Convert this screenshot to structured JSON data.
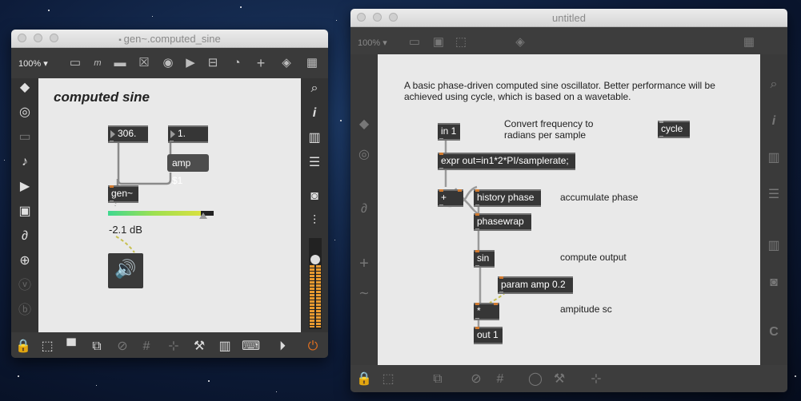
{
  "left_window": {
    "title": "gen~.computed_sine",
    "zoom": "100%",
    "patcher_title": "computed sine",
    "objects": {
      "number1": "306.",
      "number2": "1.",
      "amp_msg": "amp $1",
      "gen": "gen~",
      "gain_readout": "-2.1 dB"
    },
    "gain_level": 0.88,
    "toolbar_icons": [
      "presentation-icon",
      "math-icon",
      "comment-icon",
      "close-box-icon",
      "button-icon",
      "play-icon",
      "slider-icon",
      "dial-icon",
      "plus-icon",
      "paint-bucket-icon",
      "grid-icon"
    ],
    "sidebar_left_icons": [
      "cube-icon",
      "target-icon",
      "panel-icon",
      "music-note-icon",
      "play-list-icon",
      "image-icon",
      "paperclip-icon",
      "plug-icon",
      "v-icon",
      "b-icon"
    ],
    "sidebar_right_icons": [
      "search-icon",
      "info-icon",
      "book-icon",
      "list-icon",
      "camera-icon",
      "mixer-icon"
    ],
    "bottom_icons": [
      "lock-icon",
      "edit-icon",
      "presentation-icon",
      "window-icon",
      "hide-icon",
      "grid-icon",
      "snap-icon",
      "wrench-icon",
      "piano-icon",
      "keyboard-icon",
      "play-circle-icon",
      "power-icon"
    ]
  },
  "right_window": {
    "title": "untitled",
    "zoom": "100%",
    "description": "A basic phase-driven computed sine oscillator. Better performance will be achieved using cycle, which is based on a wavetable.",
    "objects": {
      "in1": "in 1",
      "expr": "expr out=in1*2*PI/samplerate;",
      "plus": "+",
      "history": "history phase",
      "phasewrap": "phasewrap",
      "sin": "sin",
      "param": "param amp 0.2",
      "mult": "*",
      "out1": "out 1",
      "cycle": "cycle"
    },
    "comments": {
      "convert_line1": "Convert frequency to",
      "convert_line2": "radians per sample",
      "accumulate": "accumulate phase",
      "compute": "compute output",
      "amplitude": "ampitude sc"
    }
  }
}
